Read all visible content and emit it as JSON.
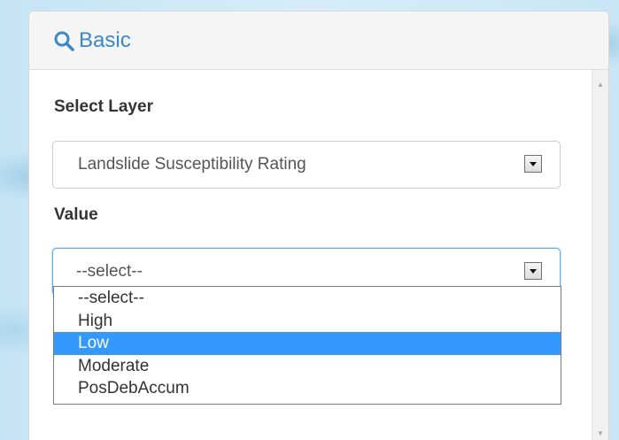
{
  "panel": {
    "title": "Basic",
    "header_icon": "search-icon"
  },
  "layer_field": {
    "label": "Select Layer",
    "selected_value": "Landslide Susceptibility Rating"
  },
  "value_field": {
    "label": "Value",
    "selected_value": "--select--",
    "options": [
      "--select--",
      "High",
      "Low",
      "Moderate",
      "PosDebAccum"
    ],
    "highlighted_option": "Low"
  },
  "colors": {
    "accent": "#3a87c9",
    "highlight": "#3399ff",
    "focus_border": "#66afe9"
  }
}
